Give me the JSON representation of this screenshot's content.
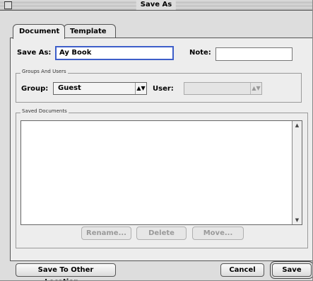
{
  "window": {
    "title": "Save As"
  },
  "tabs": [
    {
      "label": "Document",
      "active": true
    },
    {
      "label": "Template",
      "active": false
    }
  ],
  "save_as": {
    "label": "Save As:",
    "value": "Ay Book"
  },
  "note": {
    "label": "Note:",
    "value": ""
  },
  "groups_users": {
    "label": "Groups And Users",
    "group_label": "Group:",
    "group_value": "Guest",
    "user_label": "User:",
    "user_value": ""
  },
  "saved_documents": {
    "label": "Saved Documents",
    "items": []
  },
  "list_buttons": {
    "rename": "Rename...",
    "delete": "Delete",
    "move": "Move..."
  },
  "footer": {
    "other_location": "Save To Other Location...",
    "cancel": "Cancel",
    "save": "Save"
  },
  "colors": {
    "focus_ring": "#3d5ec9",
    "window_bg": "#dddddd"
  }
}
